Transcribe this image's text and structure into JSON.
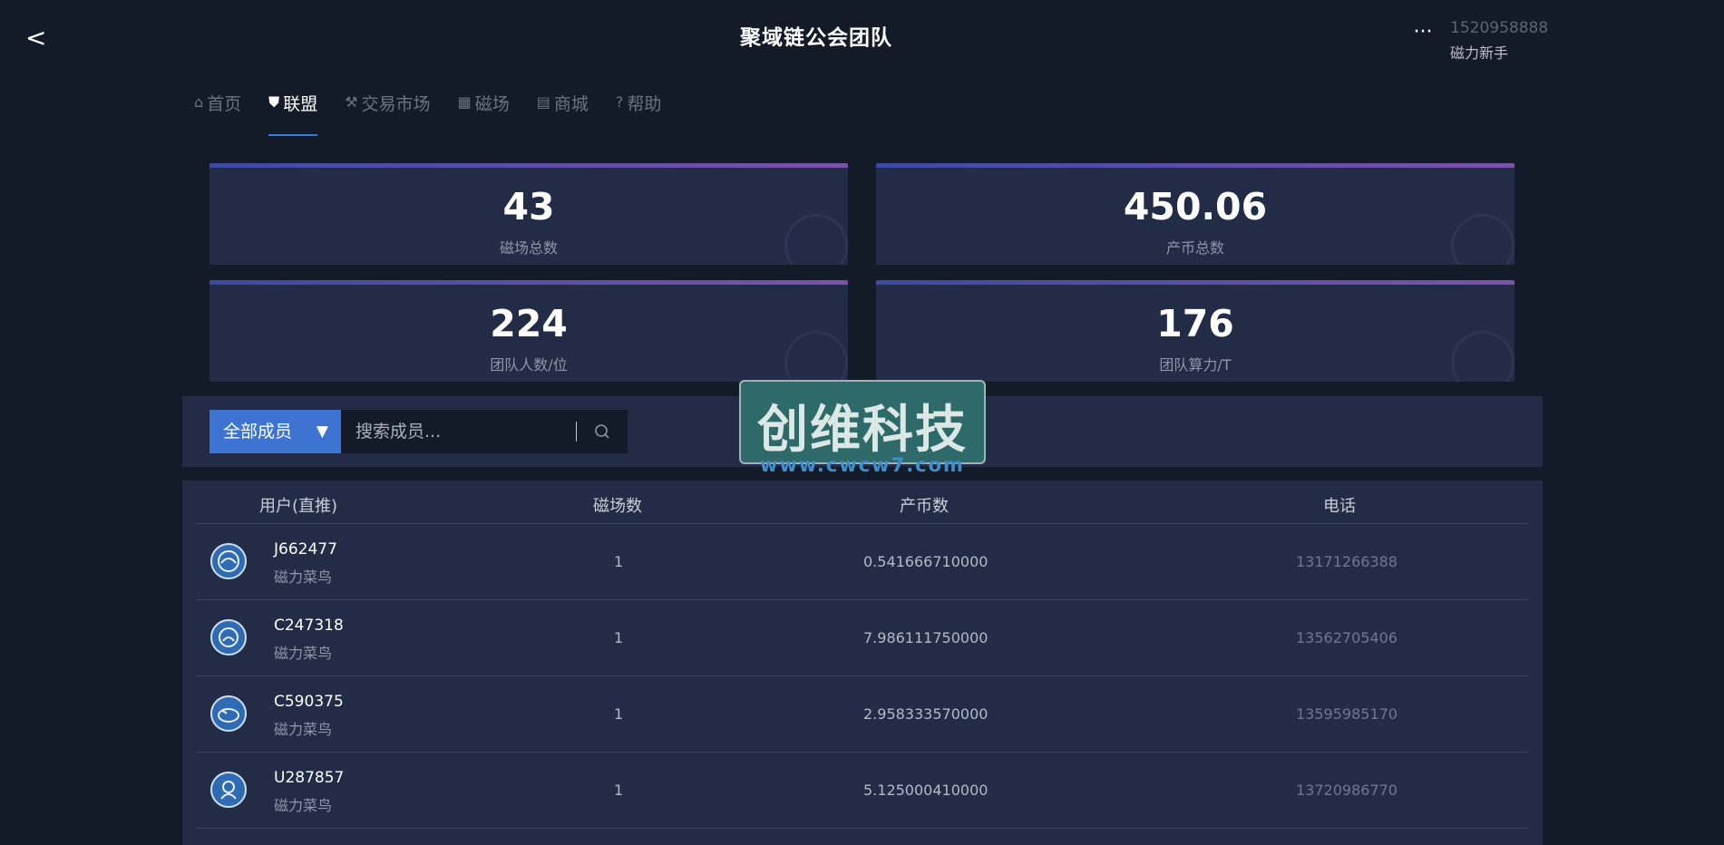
{
  "header": {
    "back_label": "<",
    "title": "聚域链公会团队",
    "more_label": "···",
    "user_phone": "1520958888",
    "user_level": "磁力新手"
  },
  "nav": [
    {
      "label": "首页",
      "icon": "home-icon",
      "glyph": "⌂",
      "active": false
    },
    {
      "label": "联盟",
      "icon": "shield-icon",
      "glyph": "⛊",
      "active": true
    },
    {
      "label": "交易市场",
      "icon": "gavel-icon",
      "glyph": "⚒",
      "active": false
    },
    {
      "label": "磁场",
      "icon": "grid-icon",
      "glyph": "▦",
      "active": false
    },
    {
      "label": "商城",
      "icon": "shop-icon",
      "glyph": "▤",
      "active": false
    },
    {
      "label": "帮助",
      "icon": "help-icon",
      "glyph": "?",
      "active": false
    }
  ],
  "stats": [
    {
      "value": "43",
      "label": "磁场总数"
    },
    {
      "value": "450.06",
      "label": "产币总数"
    },
    {
      "value": "224",
      "label": "团队人数/位"
    },
    {
      "value": "176",
      "label": "团队算力/T"
    }
  ],
  "filter": {
    "select_value": "全部成员",
    "search_placeholder": "搜索成员..."
  },
  "table": {
    "columns": [
      "用户(直推)",
      "磁场数",
      "产币数",
      "电话"
    ],
    "rows": [
      {
        "name": "J662477",
        "level": "磁力菜鸟",
        "fields": "1",
        "coins": "0.541666710000",
        "phone": "13171266388"
      },
      {
        "name": "C247318",
        "level": "磁力菜鸟",
        "fields": "1",
        "coins": "7.986111750000",
        "phone": "13562705406"
      },
      {
        "name": "C590375",
        "level": "磁力菜鸟",
        "fields": "1",
        "coins": "2.958333570000",
        "phone": "13595985170"
      },
      {
        "name": "U287857",
        "level": "磁力菜鸟",
        "fields": "1",
        "coins": "5.125000410000",
        "phone": "13720986770"
      }
    ]
  },
  "watermark": {
    "text": "创维科技",
    "url": "www.cwcw7.com"
  },
  "colors": {
    "background": "#141b28",
    "card": "#222c47",
    "accent": "#3d74d2",
    "card_top_gradient_start": "#3d4aa2",
    "card_top_gradient_end": "#7a53a8"
  }
}
